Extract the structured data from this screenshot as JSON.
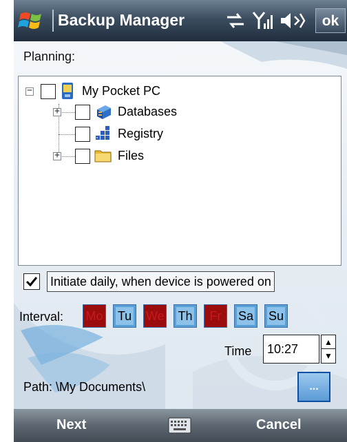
{
  "title_bar": {
    "title": "Backup Manager",
    "ok_label": "ok",
    "icons": [
      "windows-start-icon",
      "connectivity-icon",
      "signal-icon",
      "volume-icon"
    ]
  },
  "planning": {
    "label": "Planning:",
    "tree": [
      {
        "label": "My Pocket PC",
        "icon": "pocket-pc-icon",
        "checked": false,
        "expander": "−"
      },
      {
        "label": "Databases",
        "icon": "database-icon",
        "checked": false,
        "expander": "+"
      },
      {
        "label": "Registry",
        "icon": "registry-icon",
        "checked": false,
        "expander": ""
      },
      {
        "label": "Files",
        "icon": "folder-icon",
        "checked": false,
        "expander": "+"
      }
    ]
  },
  "daily": {
    "label": "Initiate daily, when device is powered on",
    "checked": true,
    "check_mark": "✓"
  },
  "interval": {
    "label": "Interval:",
    "days": [
      {
        "label": "Mo",
        "selected": true
      },
      {
        "label": "Tu",
        "selected": false
      },
      {
        "label": "We",
        "selected": true
      },
      {
        "label": "Th",
        "selected": false
      },
      {
        "label": "Fr",
        "selected": true
      },
      {
        "label": "Sa",
        "selected": false
      },
      {
        "label": "Su",
        "selected": false
      }
    ]
  },
  "time": {
    "label": "Time",
    "value": "10:27",
    "up": "▲",
    "down": "▼"
  },
  "path": {
    "label": "Path:",
    "value": "\\My Documents\\",
    "browse_label": "..."
  },
  "softkeys": {
    "left": "Next",
    "right": "Cancel"
  },
  "colors": {
    "day_selected": "#9b0c0c",
    "day_unselected": "#5aa0d8",
    "accent": "#0a4fa0"
  }
}
